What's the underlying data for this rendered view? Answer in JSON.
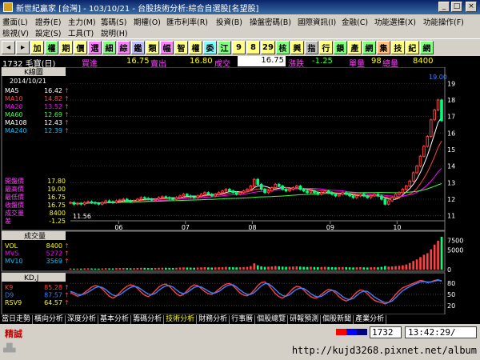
{
  "window": {
    "title": "新世紀贏家 [台灣] - 103/10/21 - 台股技術分析:綜合自選股[名望股]",
    "buttons": [
      "_",
      "□",
      "×"
    ]
  },
  "menu": {
    "row1": [
      "畫面(L)",
      "證券(E)",
      "主力(M)",
      "籌碼(S)",
      "期權(O)",
      "匯市利率(R)",
      "投資(B)",
      "操盤密碼(B)",
      "國際資訊(I)",
      "金融(C)",
      "功能選擇(X)",
      "功能操作(F)"
    ],
    "row2": [
      "檢視(V)",
      "設定(S)",
      "工具(T)",
      "說明(H)"
    ]
  },
  "toolbar": {
    "buttons": [
      "◂",
      "▸",
      "加",
      "權",
      "期",
      "價",
      "選",
      "細",
      "綜",
      "鑑",
      "類",
      "幅",
      "智",
      "權",
      "委",
      "江",
      "9",
      "8",
      "29",
      "核",
      "興",
      "指",
      "行",
      "鎖",
      "產",
      "網",
      "集",
      "技",
      "紀",
      "網"
    ]
  },
  "info": {
    "code_name": "1732 毛寶(日)",
    "bid_label": "買進",
    "bid": "16.75",
    "ask_label": "賣出",
    "ask": "16.80",
    "last_label": "成交",
    "last": "16.75",
    "change_label": "漲跌",
    "change": "-1.25",
    "qty_label": "單量",
    "qty": "98",
    "vol_label": "總量",
    "vol": "8400"
  },
  "main_panel": {
    "header": "K線圖",
    "date": "2014/10/21",
    "ma": [
      {
        "name": "MA5",
        "value": "16.42",
        "color": "#ffffff"
      },
      {
        "name": "MA10",
        "value": "14.82",
        "color": "#ff4040"
      },
      {
        "name": "MA20",
        "value": "13.52",
        "color": "#ff00ff"
      },
      {
        "name": "MA60",
        "value": "12.69",
        "color": "#40ff40"
      },
      {
        "name": "MA108",
        "value": "12.43",
        "color": "#ffffff"
      },
      {
        "name": "MA240",
        "value": "12.39",
        "color": "#00c0ff"
      }
    ],
    "ohlc": [
      {
        "name": "開盤價",
        "value": "17.80"
      },
      {
        "name": "最高價",
        "value": "19.00"
      },
      {
        "name": "最低價",
        "value": "16.75"
      },
      {
        "name": "收盤價",
        "value": "16.75"
      },
      {
        "name": "成交量",
        "value": "8400"
      },
      {
        "name": "差",
        "value": "-1.25"
      }
    ],
    "high_marker": "19.00",
    "low_marker": "11.56",
    "y_ticks": [
      "19",
      "18",
      "17",
      "16",
      "15",
      "14",
      "13",
      "12",
      "11"
    ],
    "months": [
      "06",
      "07",
      "08",
      "09",
      "10"
    ]
  },
  "volume_panel": {
    "header": "成交量",
    "rows": [
      {
        "name": "VOL",
        "value": "8400",
        "color": "#ffff00"
      },
      {
        "name": "MV5",
        "value": "5272",
        "color": "#ff00ff"
      },
      {
        "name": "MV10",
        "value": "3569",
        "color": "#00c0ff"
      }
    ],
    "y_ticks": [
      "7500",
      "5000",
      "0"
    ]
  },
  "kd_panel": {
    "header": "KD,J",
    "rows": [
      {
        "name": "K9",
        "value": "85.28",
        "color": "#ff4040"
      },
      {
        "name": "D9",
        "value": "87.57",
        "color": "#4080ff"
      },
      {
        "name": "RSV9",
        "value": "64.57",
        "color": "#ffff00"
      }
    ],
    "y_ticks": [
      "80",
      "50",
      "20"
    ]
  },
  "tabs": [
    "當日走勢",
    "橫向分析",
    "深度分析",
    "基本分析",
    "籌碼分析",
    "技術分析",
    "財務分析",
    "行事曆",
    "個股總覽",
    "研報預測",
    "個股新聞",
    "產業分析"
  ],
  "active_tab": 5,
  "status": {
    "mode": "精誠",
    "code": "1732",
    "time": "13:42:29/"
  },
  "footer": {
    "url": "http://kujd3268.pixnet.net/album"
  },
  "chart_data": {
    "type": "candlestick",
    "price_ylim": [
      10.5,
      19.5
    ],
    "volume_ylim": [
      0,
      9000
    ],
    "kd_ylim": [
      0,
      100
    ],
    "price": [
      11.8,
      11.7,
      11.75,
      11.7,
      11.8,
      11.85,
      11.8,
      11.75,
      11.7,
      11.8,
      11.9,
      11.85,
      11.8,
      11.9,
      11.95,
      12.0,
      11.9,
      11.85,
      11.9,
      12.0,
      12.1,
      12.05,
      12.0,
      11.95,
      12.0,
      12.1,
      12.15,
      12.1,
      12.05,
      12.0,
      12.1,
      12.2,
      12.3,
      12.2,
      12.15,
      12.1,
      12.2,
      12.3,
      12.4,
      12.3,
      12.2,
      12.3,
      12.4,
      12.5,
      12.6,
      12.5,
      12.4,
      12.3,
      12.4,
      12.5,
      12.6,
      12.8,
      13.2,
      12.9,
      12.6,
      12.4,
      12.5,
      12.7,
      12.9,
      12.8,
      12.6,
      12.5,
      12.6,
      12.7,
      12.8,
      12.6,
      12.5,
      12.4,
      12.5,
      12.4,
      12.3,
      12.4,
      12.5,
      12.4,
      12.3,
      12.2,
      12.3,
      12.4,
      12.3,
      12.2,
      12.1,
      12.2,
      12.3,
      12.2,
      12.1,
      12.2,
      12.3,
      12.2,
      12.0,
      11.7,
      11.9,
      12.1,
      12.3,
      12.4,
      12.6,
      12.8,
      13.1,
      13.6,
      14.0,
      14.6,
      15.2,
      15.8,
      16.8,
      17.4,
      18.0,
      16.75
    ],
    "volume": [
      300,
      250,
      280,
      260,
      320,
      340,
      300,
      280,
      260,
      300,
      360,
      320,
      300,
      380,
      400,
      420,
      380,
      340,
      360,
      420,
      460,
      440,
      400,
      380,
      420,
      460,
      480,
      460,
      440,
      420,
      460,
      520,
      560,
      520,
      500,
      480,
      520,
      560,
      600,
      560,
      520,
      560,
      600,
      640,
      700,
      640,
      600,
      560,
      600,
      640,
      700,
      900,
      1600,
      1100,
      800,
      700,
      740,
      800,
      900,
      840,
      760,
      700,
      740,
      780,
      820,
      760,
      700,
      660,
      700,
      660,
      620,
      660,
      700,
      660,
      620,
      580,
      620,
      660,
      620,
      580,
      540,
      580,
      620,
      580,
      540,
      580,
      620,
      580,
      700,
      900,
      760,
      820,
      900,
      960,
      1100,
      1300,
      1700,
      2200,
      2600,
      3200,
      3800,
      4200,
      5200,
      6400,
      7400,
      8400
    ],
    "k": [
      55,
      50,
      45,
      48,
      55,
      62,
      70,
      74,
      72,
      65,
      55,
      45,
      40,
      45,
      55,
      65,
      72,
      76,
      74,
      66,
      56,
      48,
      44,
      50,
      60,
      70,
      76,
      78,
      72,
      62,
      52,
      46,
      50,
      60,
      70,
      76,
      74,
      66,
      58,
      52,
      50,
      56,
      64,
      72,
      78,
      80,
      74,
      64,
      54,
      48,
      46,
      52,
      62,
      74,
      82,
      84,
      76,
      64,
      52,
      44,
      40,
      46,
      56,
      66,
      72,
      70,
      62,
      52,
      44,
      40,
      42,
      50,
      58,
      64,
      62,
      54,
      44,
      36,
      32,
      36,
      46,
      56,
      62,
      60,
      52,
      42,
      34,
      30,
      28,
      24,
      28,
      38,
      50,
      60,
      68,
      72,
      76,
      80,
      84,
      88,
      86,
      82,
      84,
      88,
      90,
      85
    ],
    "d": [
      58,
      55,
      50,
      49,
      51,
      56,
      62,
      68,
      71,
      69,
      63,
      55,
      48,
      46,
      49,
      56,
      63,
      69,
      72,
      70,
      64,
      57,
      51,
      49,
      53,
      61,
      68,
      73,
      74,
      70,
      62,
      55,
      52,
      55,
      62,
      69,
      72,
      70,
      65,
      59,
      54,
      54,
      58,
      65,
      72,
      76,
      76,
      70,
      62,
      55,
      50,
      50,
      55,
      64,
      73,
      79,
      79,
      72,
      63,
      54,
      47,
      45,
      49,
      57,
      64,
      67,
      66,
      60,
      52,
      46,
      43,
      45,
      51,
      58,
      61,
      59,
      52,
      44,
      38,
      36,
      39,
      47,
      55,
      59,
      58,
      51,
      43,
      37,
      32,
      28,
      28,
      32,
      41,
      51,
      60,
      66,
      71,
      76,
      80,
      84,
      85,
      84,
      84,
      86,
      88,
      87.57
    ]
  }
}
